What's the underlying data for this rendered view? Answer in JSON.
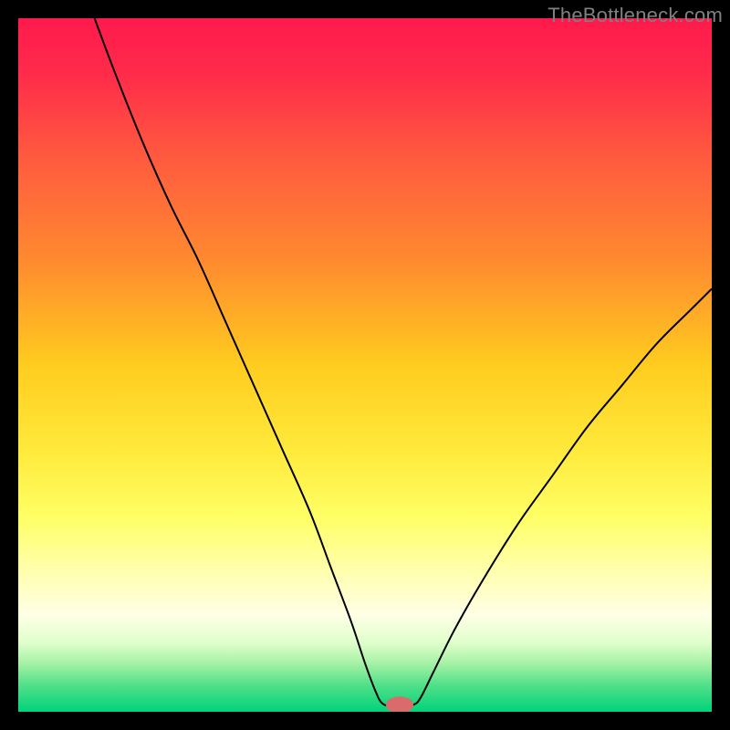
{
  "watermark": "TheBottleneck.com",
  "chart_data": {
    "type": "line",
    "title": "",
    "xlabel": "",
    "ylabel": "",
    "xlim": [
      0,
      100
    ],
    "ylim": [
      0,
      100
    ],
    "grid": false,
    "legend": false,
    "background_gradient": {
      "stops": [
        {
          "offset": 0.0,
          "color": "#ff1a4d"
        },
        {
          "offset": 0.08,
          "color": "#ff2b4a"
        },
        {
          "offset": 0.2,
          "color": "#ff5a3f"
        },
        {
          "offset": 0.35,
          "color": "#ff8a2f"
        },
        {
          "offset": 0.5,
          "color": "#ffcc1f"
        },
        {
          "offset": 0.62,
          "color": "#ffe93a"
        },
        {
          "offset": 0.72,
          "color": "#ffff66"
        },
        {
          "offset": 0.8,
          "color": "#ffffb0"
        },
        {
          "offset": 0.86,
          "color": "#ffffe6"
        },
        {
          "offset": 0.9,
          "color": "#e0ffcc"
        },
        {
          "offset": 0.93,
          "color": "#a6f2a6"
        },
        {
          "offset": 0.96,
          "color": "#55e08a"
        },
        {
          "offset": 1.0,
          "color": "#00d37a"
        }
      ]
    },
    "marker": {
      "x": 55,
      "y": 1,
      "color": "#d96b6b",
      "rx": 2.0,
      "ry": 1.2
    },
    "series": [
      {
        "name": "bottleneck-curve",
        "color": "#000000",
        "stroke_width": 2,
        "points": [
          {
            "x": 11,
            "y": 100
          },
          {
            "x": 14,
            "y": 92
          },
          {
            "x": 18,
            "y": 82
          },
          {
            "x": 22,
            "y": 73
          },
          {
            "x": 26,
            "y": 65
          },
          {
            "x": 30,
            "y": 56
          },
          {
            "x": 34,
            "y": 47
          },
          {
            "x": 38,
            "y": 38
          },
          {
            "x": 42,
            "y": 29
          },
          {
            "x": 45,
            "y": 21
          },
          {
            "x": 48,
            "y": 13
          },
          {
            "x": 50,
            "y": 7
          },
          {
            "x": 51.5,
            "y": 3
          },
          {
            "x": 52.5,
            "y": 1.2
          },
          {
            "x": 54,
            "y": 0.8
          },
          {
            "x": 56,
            "y": 0.8
          },
          {
            "x": 57,
            "y": 1.0
          },
          {
            "x": 58,
            "y": 2
          },
          {
            "x": 60,
            "y": 6
          },
          {
            "x": 63,
            "y": 12
          },
          {
            "x": 67,
            "y": 19
          },
          {
            "x": 72,
            "y": 27
          },
          {
            "x": 77,
            "y": 34
          },
          {
            "x": 82,
            "y": 41
          },
          {
            "x": 87,
            "y": 47
          },
          {
            "x": 92,
            "y": 53
          },
          {
            "x": 97,
            "y": 58
          },
          {
            "x": 100,
            "y": 61
          }
        ]
      }
    ]
  }
}
